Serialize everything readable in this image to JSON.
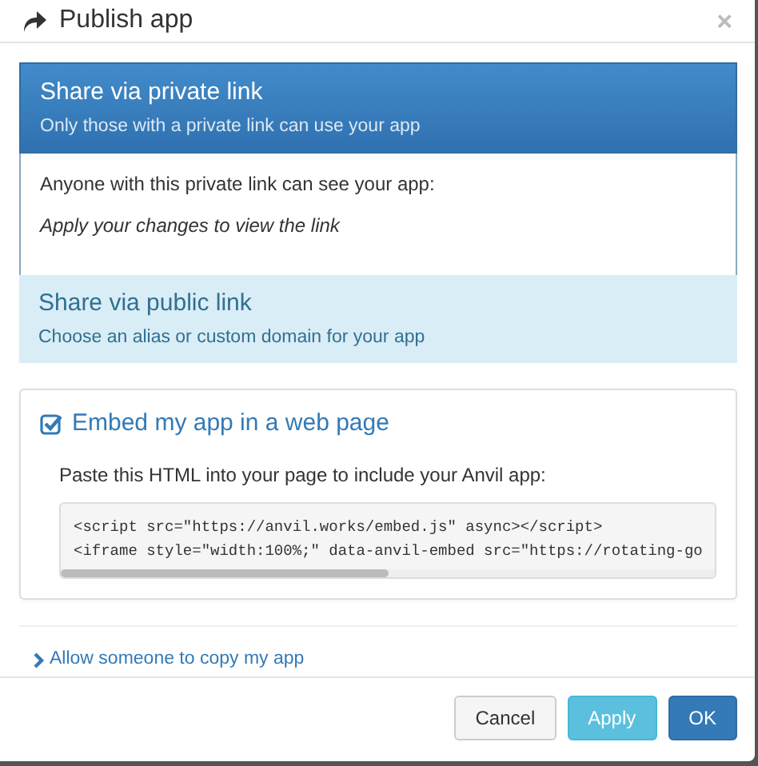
{
  "window": {
    "title": "Publish app",
    "close": "×"
  },
  "share_options": [
    {
      "title": "Share via private link",
      "subtitle": "Only those with a private link can use your app",
      "selected": true,
      "body": {
        "text": "Anyone with this private link can see your app:",
        "note": "Apply your changes to view the link"
      }
    },
    {
      "title": "Share via public link",
      "subtitle": "Choose an alias or custom domain for your app",
      "selected": false
    }
  ],
  "embed": {
    "label": "Embed my app in a web page",
    "checked": true,
    "instructions": "Paste this HTML into your page to include your Anvil app:",
    "code_lines": [
      "<script src=\"https://anvil.works/embed.js\" async></script>",
      "<iframe style=\"width:100%;\" data-anvil-embed src=\"https://rotating-go"
    ]
  },
  "copy_link": {
    "label": "Allow someone to copy my app",
    "expanded": false
  },
  "buttons": [
    {
      "label": "Cancel",
      "kind": "default"
    },
    {
      "label": "Apply",
      "kind": "info"
    },
    {
      "label": "OK",
      "kind": "primary"
    }
  ]
}
